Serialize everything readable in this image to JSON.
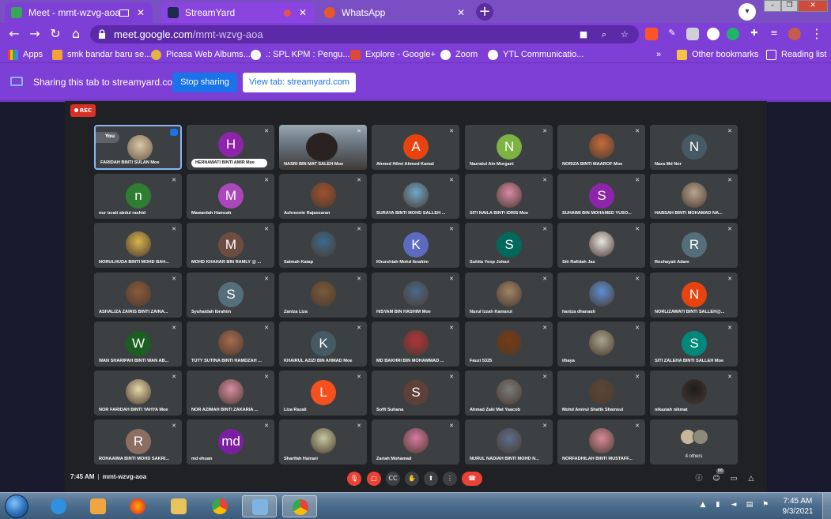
{
  "browser": {
    "tabs": [
      {
        "label": "Meet - mmt-wzvg-aoa",
        "favicon_color": "#34a853"
      },
      {
        "label": "StreamYard",
        "favicon_color": "#1d2a4d"
      },
      {
        "label": "WhatsApp",
        "favicon_color": "#e8572a"
      }
    ],
    "new_tab_symbol": "+",
    "profile_symbol": "▾",
    "window_buttons": [
      "–",
      "❐",
      "✕"
    ],
    "url_host": "meet.google.com",
    "url_path": "/mmt-wzvg-aoa",
    "nav": {
      "back": "←",
      "forward": "→",
      "reload": "↻",
      "home": "⌂"
    },
    "menu_symbol": "⋮"
  },
  "bookmarks": {
    "apps_label": "Apps",
    "items": [
      {
        "label": "smk bandar baru se...",
        "color": "#f4a235"
      },
      {
        "label": "Picasa Web Albums...",
        "color": "#e4b440"
      },
      {
        "label": ".: SPL KPM : Pengu...",
        "color": "#ffffff"
      },
      {
        "label": "Explore - Google+",
        "color": "#db4a39"
      },
      {
        "label": "Zoom",
        "color": "#ffffff"
      },
      {
        "label": "YTL Communicatio...",
        "color": "#ffffff"
      }
    ],
    "overflow": "»",
    "other_label": "Other bookmarks",
    "reading_list_label": "Reading list"
  },
  "sharing": {
    "text": "Sharing this tab to streamyard.com",
    "stop_label": "Stop sharing",
    "view_label": "View tab: streamyard.com"
  },
  "meet": {
    "rec_label": "REC",
    "self": {
      "you_label": "You",
      "name": "FARIDAH BINTI SULAN Moe"
    },
    "participants": [
      {
        "name": "FARIDAH BINTI SULAN Moe",
        "initial": "",
        "color": "",
        "kind": "self"
      },
      {
        "name": "HERNAWATI BINTI AMIR Moe",
        "initial": "H",
        "color": "#8e24aa",
        "kind": "pill"
      },
      {
        "name": "NASRI BIN MAT SALEH Moe",
        "initial": "",
        "color": "",
        "kind": "video"
      },
      {
        "name": "Ahmed Hilmi Ahmed Kamal",
        "initial": "A",
        "color": "#e8430f",
        "kind": "initial"
      },
      {
        "name": "Nazratul Ain Murgani",
        "initial": "N",
        "color": "#7cb342",
        "kind": "initial"
      },
      {
        "name": "NORIZA BINTI MAAROF Moe",
        "initial": "",
        "color": "#c96b3a",
        "kind": "photo"
      },
      {
        "name": "Naza Md Nor",
        "initial": "N",
        "color": "#455a64",
        "kind": "initial"
      },
      {
        "name": "nur izzati abdul rashid",
        "initial": "n",
        "color": "#2e7d32",
        "kind": "initial"
      },
      {
        "name": "Mawardah Hamzah",
        "initial": "M",
        "color": "#ab47bc",
        "kind": "initial"
      },
      {
        "name": "Ashreenie Rajasearan",
        "initial": "",
        "color": "#a0522d",
        "kind": "photo"
      },
      {
        "name": "SURAYA BINTI MOHD SALLEH ...",
        "initial": "",
        "color": "#6fa8c9",
        "kind": "photo"
      },
      {
        "name": "SITI NAILA BINTI IDRIS Moe",
        "initial": "",
        "color": "#d98aa8",
        "kind": "photo"
      },
      {
        "name": "SUHAIMI BIN MOHAMED YUSO...",
        "initial": "S",
        "color": "#8e24aa",
        "kind": "initial"
      },
      {
        "name": "HABSAH BINTI MOHAMAD NA...",
        "initial": "",
        "color": "#b9a690",
        "kind": "photo"
      },
      {
        "name": "NORULHUDA BINTI MOHD BAH...",
        "initial": "",
        "color": "#d9b54a",
        "kind": "photo"
      },
      {
        "name": "MOHD KHAHAR BIN RAMLY @ ...",
        "initial": "M",
        "color": "#6d4c41",
        "kind": "initial"
      },
      {
        "name": "Salmah Katap",
        "initial": "",
        "color": "#3a6b8f",
        "kind": "photo"
      },
      {
        "name": "Khurshiah Mohd Ibrahim",
        "initial": "K",
        "color": "#5c6bc0",
        "kind": "initial"
      },
      {
        "name": "Suhita Yeop Johari",
        "initial": "S",
        "color": "#00695c",
        "kind": "initial"
      },
      {
        "name": "Siti Rafidah Jas",
        "initial": "",
        "color": "#e8e4e0",
        "kind": "photo"
      },
      {
        "name": "Roshayati Adam",
        "initial": "R",
        "color": "#546e7a",
        "kind": "initial"
      },
      {
        "name": "ASHALIZA ZAIRIS BINTI ZAINA...",
        "initial": "",
        "color": "#8d5a3b",
        "kind": "photo"
      },
      {
        "name": "Syuhaidah Ibrahim",
        "initial": "S",
        "color": "#546e7a",
        "kind": "initial"
      },
      {
        "name": "Zaniza Liza",
        "initial": "",
        "color": "#7a5a3a",
        "kind": "photo"
      },
      {
        "name": "HISYAM BIN HASHIM Moe",
        "initial": "",
        "color": "#4a6b8a",
        "kind": "photo"
      },
      {
        "name": "Nurul Izzah Kamarul",
        "initial": "",
        "color": "#a08466",
        "kind": "photo"
      },
      {
        "name": "haniza dhanash",
        "initial": "",
        "color": "#5b8fd6",
        "kind": "photo"
      },
      {
        "name": "NORLIZAWATI BINTI SALLEH@...",
        "initial": "N",
        "color": "#e8430f",
        "kind": "initial"
      },
      {
        "name": "WAN SHARIPAH BINTI WAN AB...",
        "initial": "W",
        "color": "#1b5e20",
        "kind": "initial"
      },
      {
        "name": "TUTY SUTINA BINTI HAMDZAH ...",
        "initial": "",
        "color": "#a66b4f",
        "kind": "photo"
      },
      {
        "name": "KHAIRUL AZIZI BIN AHMAD Moe",
        "initial": "K",
        "color": "#455a64",
        "kind": "initial"
      },
      {
        "name": "MD BAKHRI BIN MOHAMMAD ...",
        "initial": "",
        "color": "#b0343c",
        "kind": "photo"
      },
      {
        "name": "Fauzi 5325",
        "initial": "",
        "color": "#7a3b12",
        "kind": "photo"
      },
      {
        "name": "ilhaya",
        "initial": "",
        "color": "#a8a48c",
        "kind": "photo"
      },
      {
        "name": "SITI ZALEHA BINTI SALLEH Moe",
        "initial": "S",
        "color": "#00897b",
        "kind": "initial"
      },
      {
        "name": "NOR FARIDAH BINTI YAHYA Moe",
        "initial": "",
        "color": "#e6d9a8",
        "kind": "photo"
      },
      {
        "name": "NOR AZIMAH BINTI ZAKARIA ...",
        "initial": "",
        "color": "#d78fa1",
        "kind": "photo"
      },
      {
        "name": "Liza Razali",
        "initial": "L",
        "color": "#f4511e",
        "kind": "initial"
      },
      {
        "name": "Soffi Suhana",
        "initial": "S",
        "color": "#5d4037",
        "kind": "initial"
      },
      {
        "name": "Ahmad Zaki Mat Yaacob",
        "initial": "",
        "color": "#7b7b7b",
        "kind": "photo"
      },
      {
        "name": "Mohd Amirul Shafik Shamsul",
        "initial": "",
        "color": "#5b4636",
        "kind": "photo"
      },
      {
        "name": "nikaziah nikmat",
        "initial": "",
        "color": "#1c1c1c",
        "kind": "photo"
      },
      {
        "name": "ROHAAIMA BINTI MOHD SAKRI...",
        "initial": "R",
        "color": "#8d6e63",
        "kind": "initial"
      },
      {
        "name": "md ehuan",
        "initial": "md",
        "color": "#7b1fa2",
        "kind": "initial"
      },
      {
        "name": "Sharifah Hairani",
        "initial": "",
        "color": "#c7c9a0",
        "kind": "photo"
      },
      {
        "name": "Zariah Mohamad",
        "initial": "",
        "color": "#d77aa0",
        "kind": "photo"
      },
      {
        "name": "NURUL NADIAH BINTI MOHD N...",
        "initial": "",
        "color": "#5a6f8a",
        "kind": "photo"
      },
      {
        "name": "NORFADHILAH BINTI MUSTAFF...",
        "initial": "",
        "color": "#d98a9a",
        "kind": "photo"
      },
      {
        "name": "4 others",
        "initial": "",
        "color": "",
        "kind": "others"
      }
    ],
    "bottom": {
      "time": "7:45 AM",
      "code": "mmt-wzvg-aoa",
      "people_count": "66"
    }
  },
  "taskbar": {
    "clock_time": "7:45 AM",
    "clock_date": "9/3/2021"
  }
}
